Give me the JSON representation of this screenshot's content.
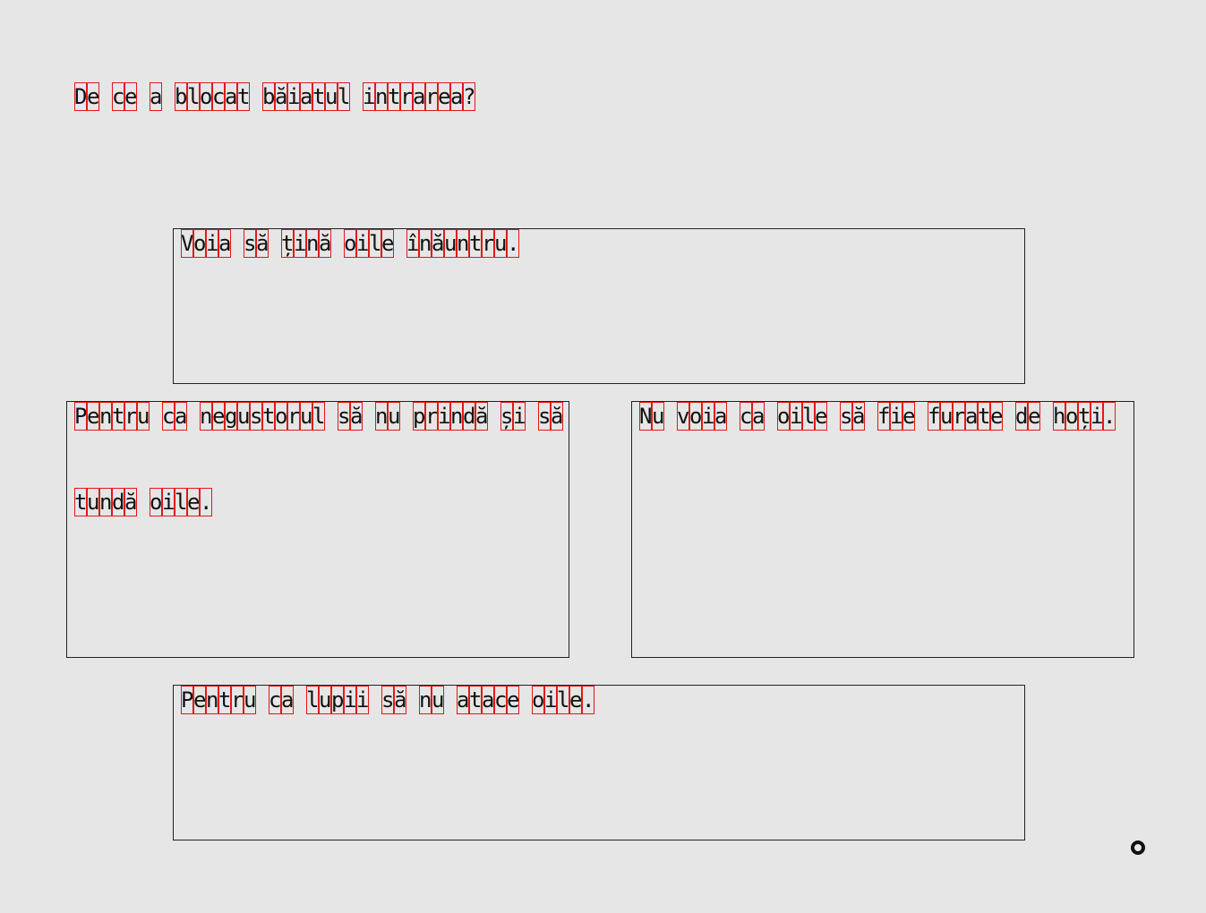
{
  "question": "De ce a blocat băiatul intrarea?",
  "answers": [
    {
      "lines": [
        "Voia să țină oile înăuntru."
      ]
    },
    {
      "lines": [
        "Pentru ca negustorul să nu prindă și să",
        "tundă oile."
      ]
    },
    {
      "lines": [
        "Nu voia ca oile să fie furate de hoți."
      ]
    },
    {
      "lines": [
        "Pentru ca lupii să nu atace oile."
      ]
    }
  ],
  "cursor": {
    "icon": "cursor-ring-icon"
  }
}
